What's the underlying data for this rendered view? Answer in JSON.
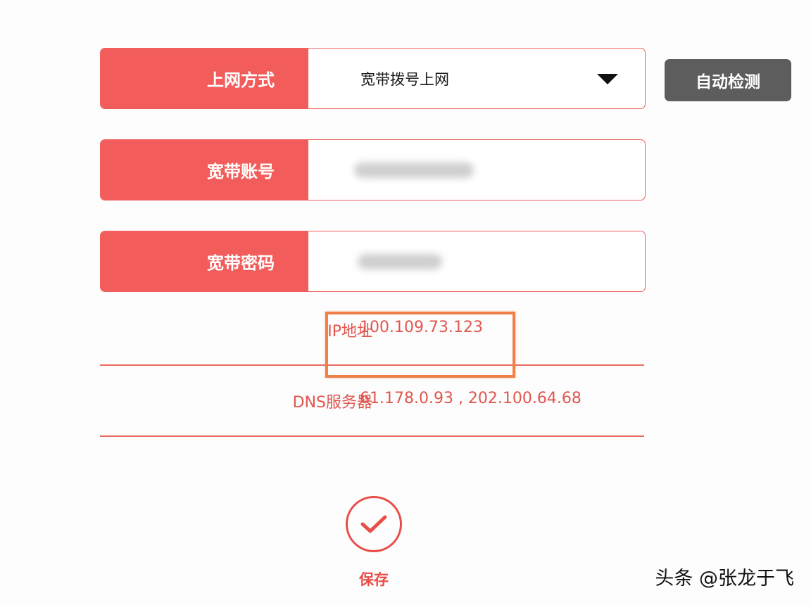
{
  "connection_type": {
    "label": "上网方式",
    "value": "宽带拨号上网",
    "dropdown_icon": "chevron-down-icon"
  },
  "auto_detect_button": {
    "label": "自动检测"
  },
  "account": {
    "label": "宽带账号",
    "value_redacted": true
  },
  "password": {
    "label": "宽带密码",
    "value_redacted": true
  },
  "ip_address": {
    "label": "IP地址",
    "value": "100.109.73.123"
  },
  "dns": {
    "label": "DNS服务器",
    "value": "61.178.0.93 , 202.100.64.68"
  },
  "save_button": {
    "icon": "checkmark-icon",
    "label": "保存"
  },
  "watermark": {
    "text": "头条 @张龙于飞"
  },
  "colors": {
    "accent": "#f25d5b",
    "info_text": "#e0564f",
    "highlight": "#f08049",
    "button_gray": "#5d5d5d"
  }
}
